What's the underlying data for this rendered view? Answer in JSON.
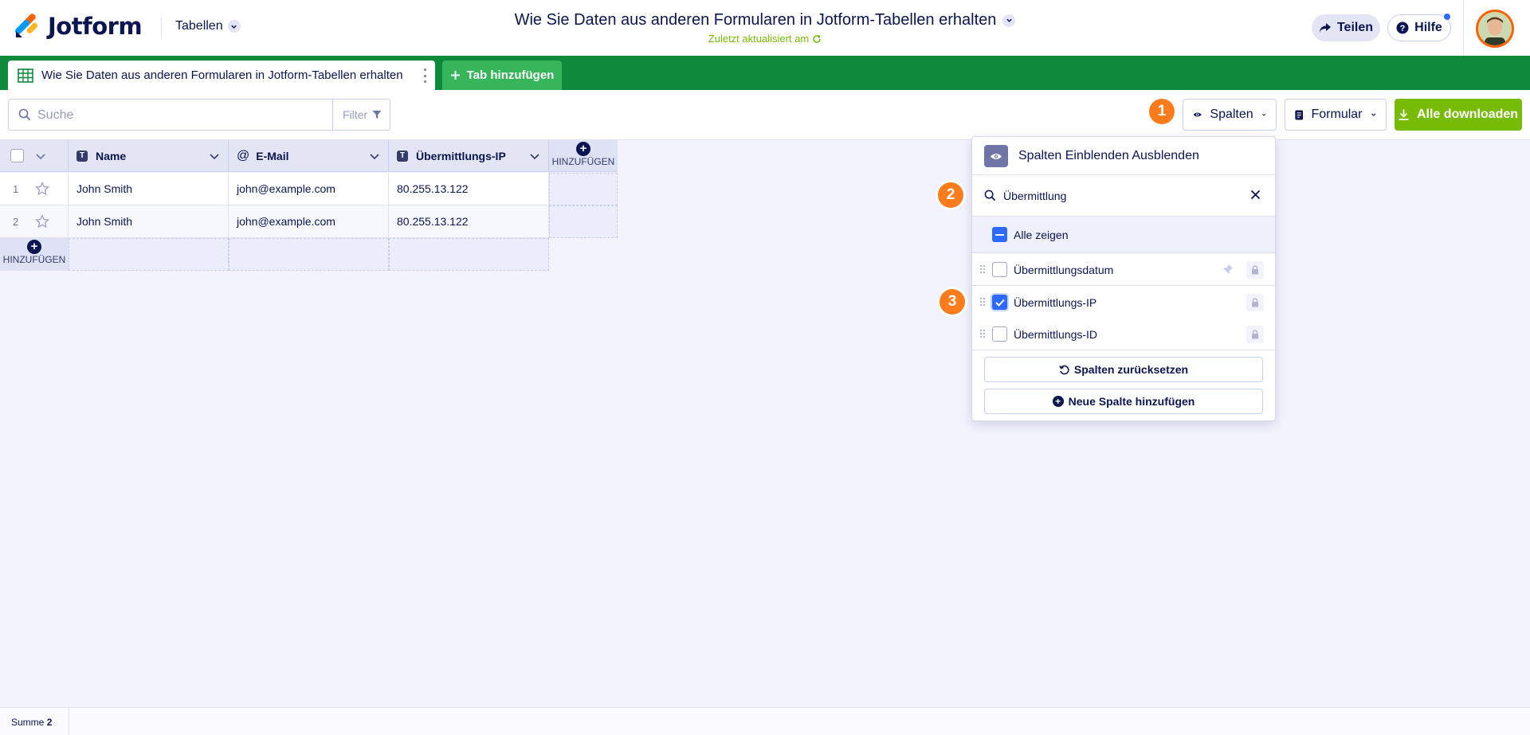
{
  "header": {
    "logo_text": "Jotform",
    "product_menu": "Tabellen",
    "title": "Wie Sie Daten aus anderen Formularen in Jotform-Tabellen erhalten",
    "subtitle": "Zuletzt aktualisiert am",
    "share_label": "Teilen",
    "help_label": "Hilfe"
  },
  "tabs": {
    "active_tab": "Wie Sie Daten aus anderen Formularen in Jotform-Tabellen erhalten",
    "add_tab": "Tab hinzufügen"
  },
  "toolbar": {
    "search_placeholder": "Suche",
    "filter_label": "Filter",
    "columns_label": "Spalten",
    "form_label": "Formular",
    "download_label": "Alle downloaden"
  },
  "badges": [
    "1",
    "2",
    "3"
  ],
  "table": {
    "columns": [
      {
        "label": "Name",
        "type": "text"
      },
      {
        "label": "E-Mail",
        "type": "email"
      },
      {
        "label": "Übermittlungs-IP",
        "type": "text"
      }
    ],
    "add_column_label": "HINZUFÜGEN",
    "add_row_label": "HINZUFÜGEN",
    "rows": [
      {
        "num": "1",
        "cells": [
          "John Smith",
          "john@example.com",
          "80.255.13.122"
        ]
      },
      {
        "num": "2",
        "cells": [
          "John Smith",
          "john@example.com",
          "80.255.13.122"
        ]
      }
    ]
  },
  "footer": {
    "sum_label": "Summe",
    "sum_value": "2"
  },
  "columns_panel": {
    "title": "Spalten Einblenden Ausblenden",
    "search_value": "Übermittlung",
    "show_all_label": "Alle zeigen",
    "items": [
      {
        "label": "Übermittlungsdatum",
        "checked": false
      },
      {
        "label": "Übermittlungs-IP",
        "checked": true
      },
      {
        "label": "Übermittlungs-ID",
        "checked": false
      }
    ],
    "reset_label": "Spalten zurücksetzen",
    "new_column_label": "Neue Spalte hinzufügen"
  },
  "colors": {
    "brand_navy": "#0a1551",
    "tab_bar_green": "#0d8a3b",
    "download_green": "#78bb07",
    "badge_orange": "#ff7b1c",
    "check_blue": "#2e69ff"
  }
}
